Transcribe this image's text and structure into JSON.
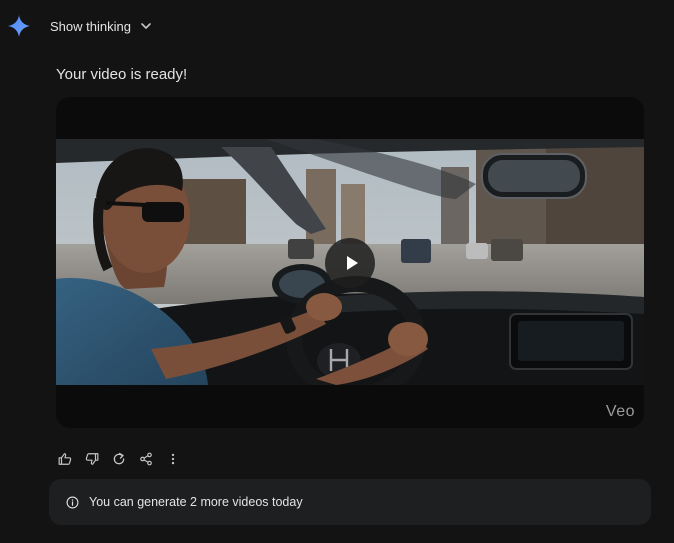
{
  "header": {
    "assistant_icon": "gemini-sparkle-icon",
    "thinking_label": "Show thinking",
    "thinking_chevron_icon": "chevron-down-icon"
  },
  "message": {
    "text": "Your video is ready!"
  },
  "video": {
    "play_icon": "play-icon",
    "watermark": "Veo"
  },
  "actions": [
    {
      "name": "thumbs-up",
      "icon": "thumbs-up-icon"
    },
    {
      "name": "thumbs-down",
      "icon": "thumbs-down-icon"
    },
    {
      "name": "regenerate",
      "icon": "refresh-icon"
    },
    {
      "name": "share",
      "icon": "share-icon"
    },
    {
      "name": "more",
      "icon": "more-vertical-icon"
    }
  ],
  "info_banner": {
    "icon": "info-icon",
    "text": "You can generate 2 more videos today"
  },
  "colors": {
    "background": "#131314",
    "accent": "#4b8dfb",
    "banner": "#1e1f20",
    "text": "#e3e3e3"
  }
}
